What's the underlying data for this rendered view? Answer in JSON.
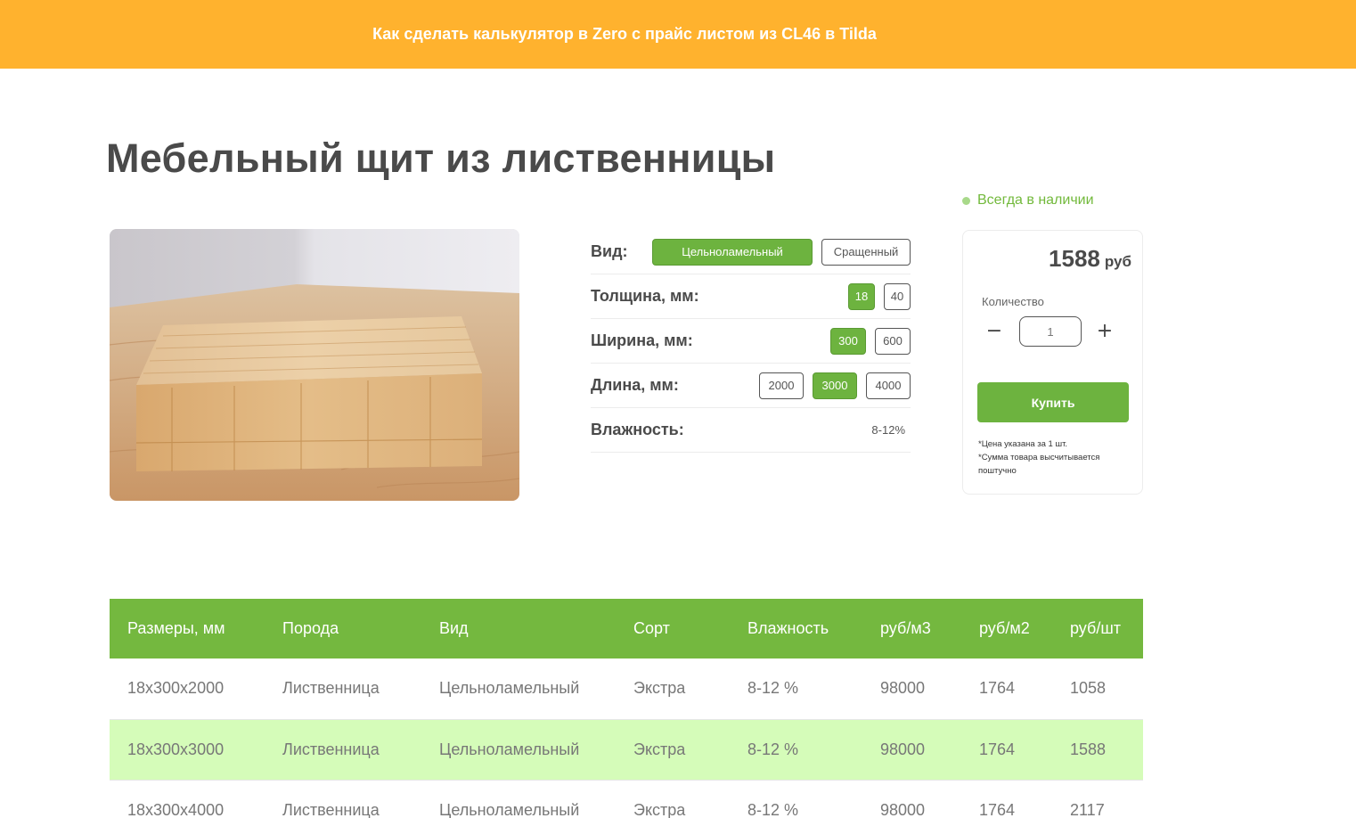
{
  "banner": {
    "link_text": "Как сделать калькулятор в Zero с прайс листом из CL46 в Tilda"
  },
  "product": {
    "title": "Мебельный щит из лиственницы",
    "stock_status": "Всегда в наличии"
  },
  "options": {
    "type": {
      "label": "Вид:",
      "choices": [
        "Цельноламельный",
        "Сращенный"
      ],
      "selected": "Цельноламельный"
    },
    "thickness": {
      "label": "Толщина, мм:",
      "choices": [
        "18",
        "40"
      ],
      "selected": "18"
    },
    "width": {
      "label": "Ширина, мм:",
      "choices": [
        "300",
        "600"
      ],
      "selected": "300"
    },
    "length": {
      "label": "Длина, мм:",
      "choices": [
        "2000",
        "3000",
        "4000"
      ],
      "selected": "3000"
    },
    "moisture": {
      "label": "Влажность:",
      "value": "8-12%"
    }
  },
  "buy_card": {
    "price": "1588",
    "currency": "руб",
    "qty_label": "Количество",
    "qty_value": "1",
    "minus": "−",
    "plus": "+",
    "buy_label": "Купить",
    "note1": "*Цена указана за 1 шт.",
    "note2": "*Сумма товара высчитывается поштучно"
  },
  "table": {
    "headers": [
      "Размеры, мм",
      "Порода",
      "Вид",
      "Сорт",
      "Влажность",
      "руб/м3",
      "руб/м2",
      "руб/шт"
    ],
    "rows": [
      [
        "18х300х2000",
        "Лиственница",
        "Цельноламельный",
        "Экстра",
        "8-12 %",
        "98000",
        "1764",
        "1058"
      ],
      [
        "18х300х3000",
        "Лиственница",
        "Цельноламельный",
        "Экстра",
        "8-12 %",
        "98000",
        "1764",
        "1588"
      ],
      [
        "18х300х4000",
        "Лиственница",
        "Цельноламельный",
        "Экстра",
        "8-12 %",
        "98000",
        "1764",
        "2117"
      ]
    ],
    "highlight_row": 1
  },
  "colors": {
    "banner": "#ffb22e",
    "accent": "#6db33f",
    "table_header": "#74b83f",
    "row_highlight": "#d5fcb9"
  },
  "image": {
    "icon": "wood-panel-photo"
  }
}
